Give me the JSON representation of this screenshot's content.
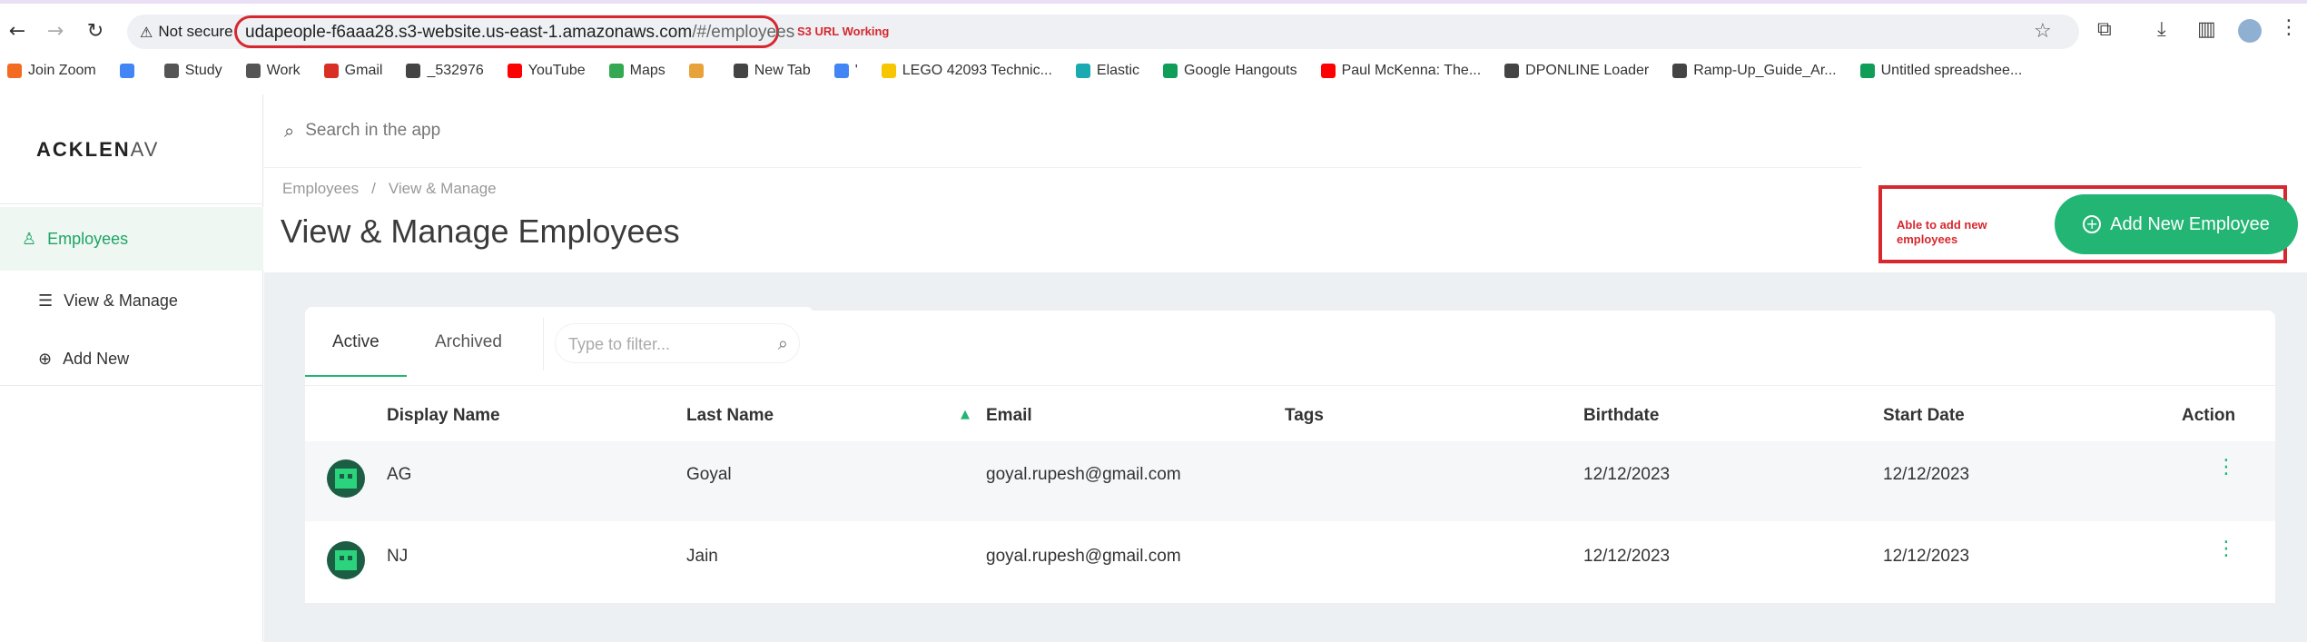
{
  "browser": {
    "not_secure": "Not secure",
    "url_host": "udapeople-f6aaa28.s3-website.us-east-1.amazonaws.com",
    "url_path": "/#/employees",
    "annotation": "S3 URL Working"
  },
  "bookmarks": [
    {
      "label": "Join Zoom",
      "icon": "zoom-icon",
      "color": "#f26b21"
    },
    {
      "label": "",
      "icon": "google-icon",
      "color": "#4285f4"
    },
    {
      "label": "Study",
      "icon": "folder-icon",
      "color": "#555555"
    },
    {
      "label": "Work",
      "icon": "folder-icon",
      "color": "#555555"
    },
    {
      "label": "Gmail",
      "icon": "gmail-icon",
      "color": "#d93025"
    },
    {
      "label": "_532976",
      "icon": "globe-icon",
      "color": "#444444"
    },
    {
      "label": "YouTube",
      "icon": "youtube-icon",
      "color": "#ff0000"
    },
    {
      "label": "Maps",
      "icon": "maps-icon",
      "color": "#34a853"
    },
    {
      "label": "",
      "icon": "app-icon",
      "color": "#e8a23a"
    },
    {
      "label": "New Tab",
      "icon": "globe-icon",
      "color": "#444444"
    },
    {
      "label": "'",
      "icon": "google-icon",
      "color": "#4285f4"
    },
    {
      "label": "LEGO 42093 Technic...",
      "icon": "lego-icon",
      "color": "#f7c600"
    },
    {
      "label": "Elastic",
      "icon": "elastic-icon",
      "color": "#1ba9b2"
    },
    {
      "label": "Google Hangouts",
      "icon": "hangouts-icon",
      "color": "#0f9d58"
    },
    {
      "label": "Paul McKenna: The...",
      "icon": "youtube-icon",
      "color": "#ff0000"
    },
    {
      "label": "DPONLINE Loader",
      "icon": "globe-icon",
      "color": "#444444"
    },
    {
      "label": "Ramp-Up_Guide_Ar...",
      "icon": "globe-icon",
      "color": "#444444"
    },
    {
      "label": "Untitled spreadshee...",
      "icon": "sheets-icon",
      "color": "#0f9d58"
    }
  ],
  "app": {
    "logo_main": "ACKLEN",
    "logo_tail": "AV",
    "sidebar": [
      {
        "label": "Employees",
        "icon": "person-icon"
      },
      {
        "label": "View & Manage",
        "icon": "list-icon"
      },
      {
        "label": "Add New",
        "icon": "plus-circle-icon"
      }
    ],
    "search_placeholder": "Search in the app",
    "breadcrumb": [
      "Employees",
      "/",
      "View & Manage"
    ],
    "page_title": "View & Manage Employees",
    "add_note": "Able to add new employees",
    "add_button": "Add New Employee",
    "tabs": [
      "Active",
      "Archived"
    ],
    "filter_placeholder": "Type to filter...",
    "columns": [
      "Display Name",
      "Last Name",
      "Email",
      "Tags",
      "Birthdate",
      "Start Date",
      "Action"
    ],
    "rows": [
      {
        "display": "AG",
        "last": "Goyal",
        "email": "goyal.rupesh@gmail.com",
        "tags": "",
        "birth": "12/12/2023",
        "start": "12/12/2023"
      },
      {
        "display": "NJ",
        "last": "Jain",
        "email": "goyal.rupesh@gmail.com",
        "tags": "",
        "birth": "12/12/2023",
        "start": "12/12/2023"
      }
    ],
    "accent": "#23b574"
  }
}
